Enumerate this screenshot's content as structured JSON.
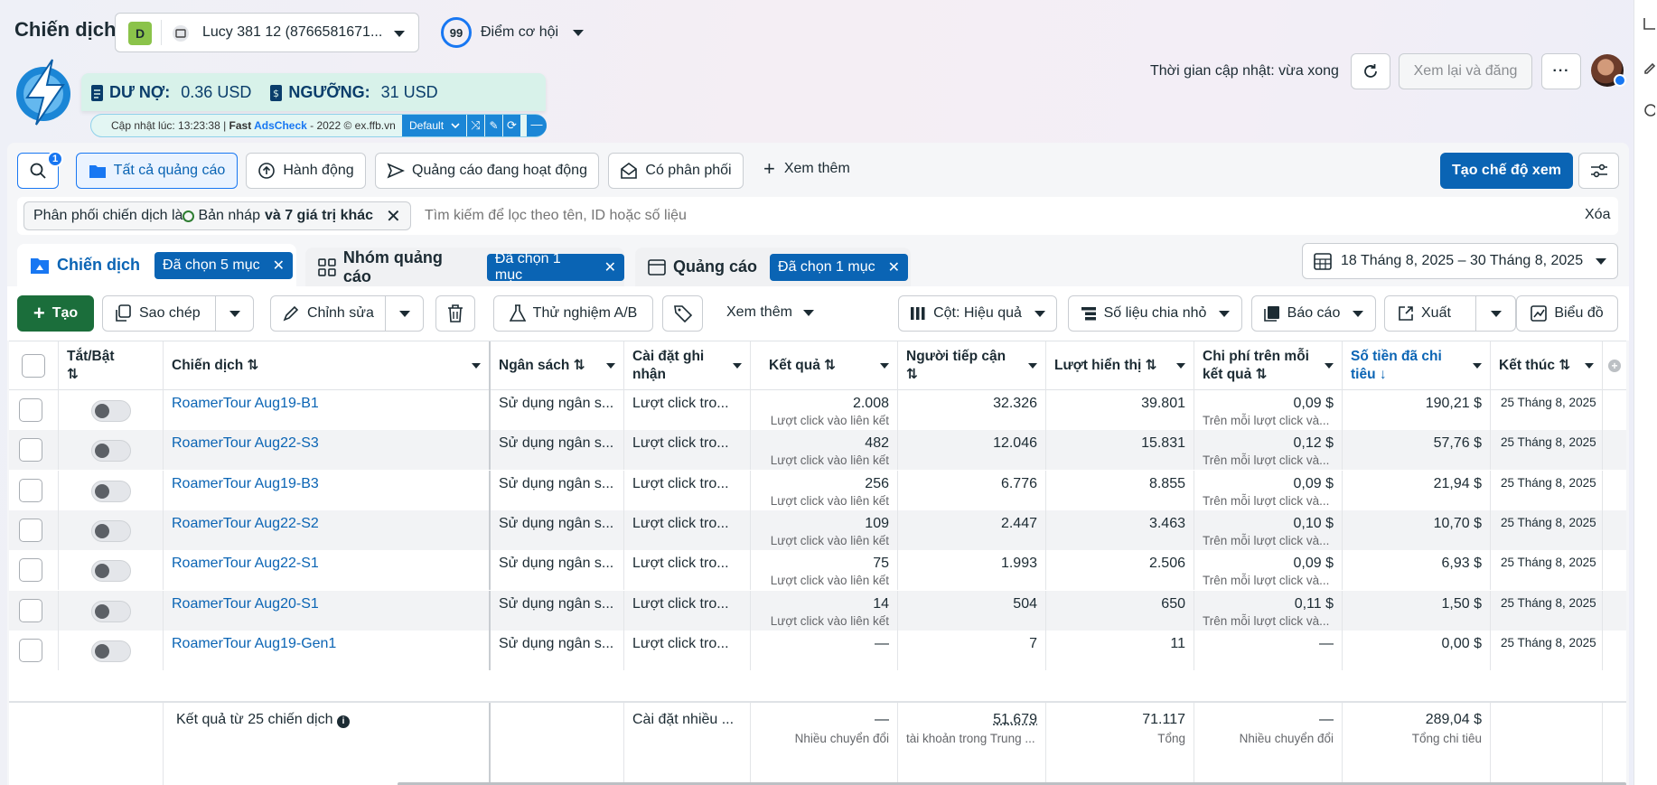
{
  "header": {
    "title": "Chiến dịch",
    "account_initial": "D",
    "account_name": "Lucy 381 12 (8766581671...",
    "score_value": "99",
    "score_label": "Điểm cơ hội",
    "update_time": "Thời gian cập nhật: vừa xong",
    "review_publish": "Xem lại và đăng"
  },
  "widget": {
    "debt_label": "DƯ NỢ:",
    "debt_value": "0.36 USD",
    "threshold_label": "NGƯỠNG:",
    "threshold_value": "31 USD",
    "update_prefix": "Cập nhật lúc: 13:23:38 | ",
    "brand_fast": "Fast ",
    "brand_ads": "AdsCheck",
    "update_suffix": " - 2022 © ex.ffb.vn",
    "profile": "Default"
  },
  "filters": {
    "search_badge": "1",
    "all_ads": "Tất cả quảng cáo",
    "actions": "Hành động",
    "active_ads": "Quảng cáo đang hoạt động",
    "delivering": "Có phân phối",
    "see_more": "Xem thêm",
    "create_view": "Tạo chế độ xem",
    "chip_text": "Phân phối chiến dịch là ",
    "chip_draft": "Bản nháp",
    "chip_more": "và 7 giá trị khác",
    "search_placeholder": "Tìm kiếm để lọc theo tên, ID hoặc số liệu",
    "clear": "Xóa"
  },
  "tabs": {
    "campaign": "Chiến dịch",
    "campaign_sel": "Đã chọn 5 mục",
    "adset": "Nhóm quảng cáo",
    "adset_sel": "Đã chọn 1 mục",
    "ad": "Quảng cáo",
    "ad_sel": "Đã chọn 1 mục",
    "date_range": "18 Tháng 8, 2025 – 30 Tháng 8, 2025"
  },
  "toolbar": {
    "create": "Tạo",
    "copy": "Sao chép",
    "edit": "Chỉnh sửa",
    "ab_test": "Thử nghiệm A/B",
    "see_more": "Xem thêm",
    "columns": "Cột: Hiệu quả",
    "breakdown": "Số liệu chia nhỏ",
    "reports": "Báo cáo",
    "export": "Xuất",
    "charts": "Biểu đồ"
  },
  "columns": {
    "toggle": "Tắt/Bật",
    "campaign": "Chiến dịch",
    "budget": "Ngân sách",
    "attribution": "Cài đặt ghi nhận",
    "results": "Kết quả",
    "reach": "Người tiếp cận",
    "impressions": "Lượt hiển thị",
    "cost_per_result": "Chi phí trên mỗi kết quả",
    "amount_spent": "Số tiền đã chi tiêu",
    "ends": "Kết thúc"
  },
  "rows": [
    {
      "name": "RoamerTour Aug19-B1",
      "budget": "Sử dụng ngân s...",
      "attribution": "Lượt click tro...",
      "results": "2.008",
      "results_sub": "Lượt click vào liên kết",
      "reach": "32.326",
      "impressions": "39.801",
      "cpr": "0,09 $",
      "cpr_sub": "Trên mỗi lượt click và...",
      "spent": "190,21 $",
      "ends": "25 Tháng 8, 2025"
    },
    {
      "name": "RoamerTour Aug22-S3",
      "budget": "Sử dụng ngân s...",
      "attribution": "Lượt click tro...",
      "results": "482",
      "results_sub": "Lượt click vào liên kết",
      "reach": "12.046",
      "impressions": "15.831",
      "cpr": "0,12 $",
      "cpr_sub": "Trên mỗi lượt click và...",
      "spent": "57,76 $",
      "ends": "25 Tháng 8, 2025"
    },
    {
      "name": "RoamerTour Aug19-B3",
      "budget": "Sử dụng ngân s...",
      "attribution": "Lượt click tro...",
      "results": "256",
      "results_sub": "Lượt click vào liên kết",
      "reach": "6.776",
      "impressions": "8.855",
      "cpr": "0,09 $",
      "cpr_sub": "Trên mỗi lượt click và...",
      "spent": "21,94 $",
      "ends": "25 Tháng 8, 2025"
    },
    {
      "name": "RoamerTour Aug22-S2",
      "budget": "Sử dụng ngân s...",
      "attribution": "Lượt click tro...",
      "results": "109",
      "results_sub": "Lượt click vào liên kết",
      "reach": "2.447",
      "impressions": "3.463",
      "cpr": "0,10 $",
      "cpr_sub": "Trên mỗi lượt click và...",
      "spent": "10,70 $",
      "ends": "25 Tháng 8, 2025"
    },
    {
      "name": "RoamerTour Aug22-S1",
      "budget": "Sử dụng ngân s...",
      "attribution": "Lượt click tro...",
      "results": "75",
      "results_sub": "Lượt click vào liên kết",
      "reach": "1.993",
      "impressions": "2.506",
      "cpr": "0,09 $",
      "cpr_sub": "Trên mỗi lượt click và...",
      "spent": "6,93 $",
      "ends": "25 Tháng 8, 2025"
    },
    {
      "name": "RoamerTour Aug20-S1",
      "budget": "Sử dụng ngân s...",
      "attribution": "Lượt click tro...",
      "results": "14",
      "results_sub": "Lượt click vào liên kết",
      "reach": "504",
      "impressions": "650",
      "cpr": "0,11 $",
      "cpr_sub": "Trên mỗi lượt click và...",
      "spent": "1,50 $",
      "ends": "25 Tháng 8, 2025"
    },
    {
      "name": "RoamerTour Aug19-Gen1",
      "budget": "Sử dụng ngân s...",
      "attribution": "Lượt click tro...",
      "results": "—",
      "results_sub": "",
      "reach": "7",
      "impressions": "11",
      "cpr": "—",
      "cpr_sub": "",
      "spent": "0,00 $",
      "ends": "25 Tháng 8, 2025"
    }
  ],
  "footer": {
    "label": "Kết quả từ 25 chiến dịch",
    "attribution": "Cài đặt nhiều ...",
    "results": "—",
    "results_sub": "Nhiều chuyển đổi",
    "reach": "51.679",
    "reach_sub": "tài khoản trong Trung ...",
    "impressions": "71.117",
    "impressions_sub": "Tổng",
    "cpr": "—",
    "cpr_sub": "Nhiều chuyển đổi",
    "spent": "289,04 $",
    "spent_sub": "Tổng chi tiêu"
  },
  "colors": {
    "primary": "#0a64b4",
    "create_green": "#1b6e3b",
    "text": "#1c2b33"
  }
}
